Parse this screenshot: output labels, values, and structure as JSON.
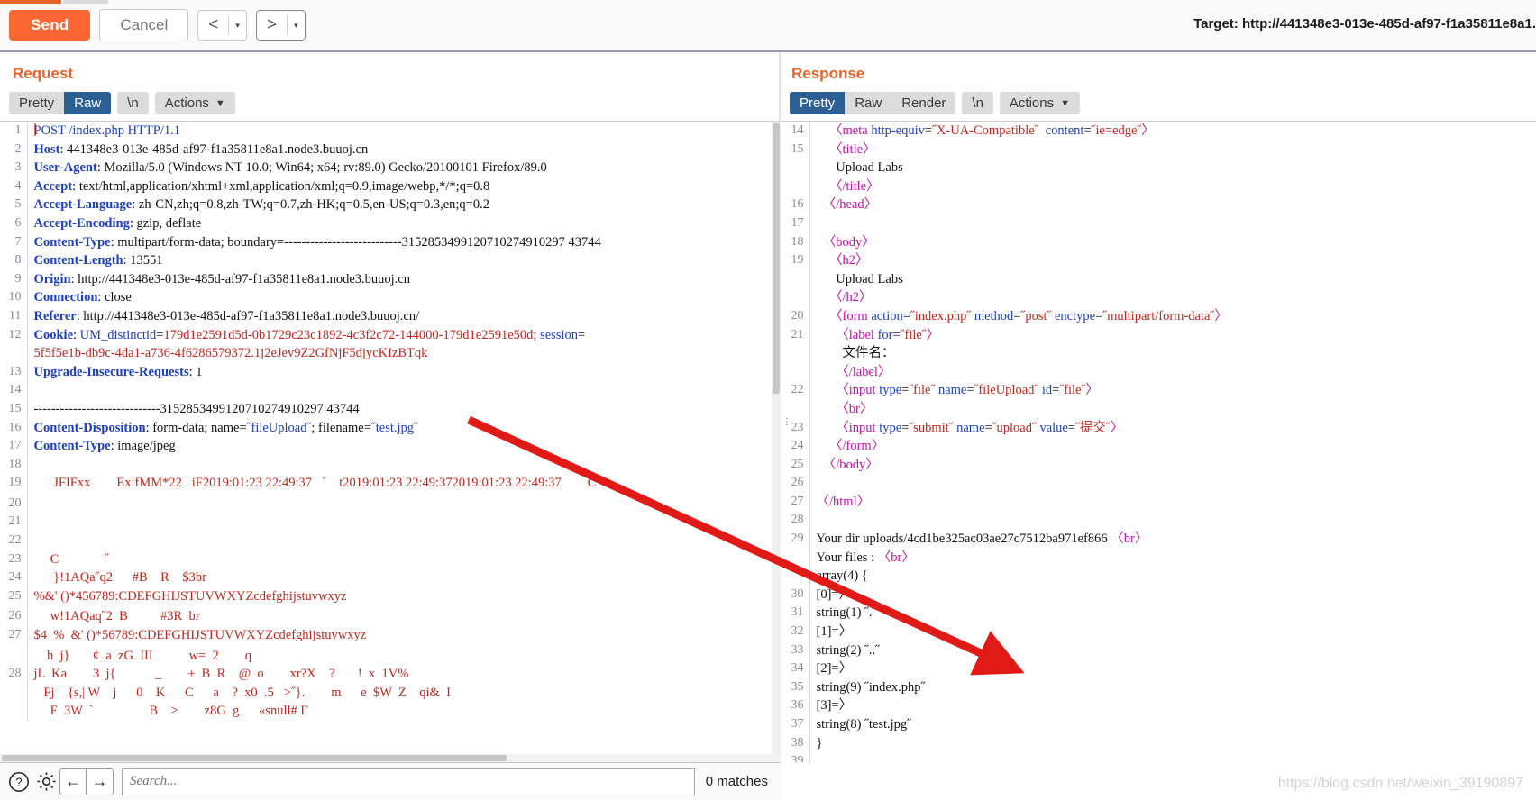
{
  "toolbar": {
    "send_label": "Send",
    "cancel_label": "Cancel",
    "prev_arrow": "<",
    "next_arrow": ">",
    "caret": "▾",
    "target_label": "Target: http://441348e3-013e-485d-af97-f1a35811e8a1."
  },
  "request": {
    "title": "Request",
    "tabs": {
      "pretty": "Pretty",
      "raw": "Raw",
      "newline": "\\n",
      "actions": "Actions"
    },
    "search_placeholder": "Search...",
    "matches": "0 matches",
    "lines": [
      {
        "n": "1",
        "segs": [
          {
            "t": "POST /index.php HTTP/1.1",
            "c": "blue"
          }
        ],
        "caret": true
      },
      {
        "n": "2",
        "segs": [
          {
            "t": "Host",
            "c": "hdrname"
          },
          {
            "t": ": ",
            "c": "blk"
          },
          {
            "t": "441348e3-013e-485d-af97-f1a35811e8a1.node3.buuoj.cn",
            "c": "blk"
          }
        ]
      },
      {
        "n": "3",
        "segs": [
          {
            "t": "User-Agent",
            "c": "hdrname"
          },
          {
            "t": ": Mozilla/5.0 (Windows NT 10.0; Win64; x64; rv:89.0) Gecko/20100101 Firefox/89.0",
            "c": "blk"
          }
        ]
      },
      {
        "n": "4",
        "segs": [
          {
            "t": "Accept",
            "c": "hdrname"
          },
          {
            "t": ": text/html,application/xhtml+xml,application/xml;q=0.9,image/webp,*/*;q=0.8",
            "c": "blk"
          }
        ]
      },
      {
        "n": "5",
        "segs": [
          {
            "t": "Accept-Language",
            "c": "hdrname"
          },
          {
            "t": ": zh-CN,zh;q=0.8,zh-TW;q=0.7,zh-HK;q=0.5,en-US;q=0.3,en;q=0.2",
            "c": "blk"
          }
        ]
      },
      {
        "n": "6",
        "segs": [
          {
            "t": "Accept-Encoding",
            "c": "hdrname"
          },
          {
            "t": ": gzip, deflate",
            "c": "blk"
          }
        ]
      },
      {
        "n": "7",
        "segs": [
          {
            "t": "Content-Type",
            "c": "hdrname"
          },
          {
            "t": ": multipart/form-data; boundary=---------------------------3152853499120710274910297 43744",
            "c": "blk"
          }
        ]
      },
      {
        "n": "8",
        "segs": [
          {
            "t": "Content-Length",
            "c": "hdrname"
          },
          {
            "t": ": 13551",
            "c": "blk"
          }
        ]
      },
      {
        "n": "9",
        "segs": [
          {
            "t": "Origin",
            "c": "hdrname"
          },
          {
            "t": ": http://441348e3-013e-485d-af97-f1a35811e8a1.node3.buuoj.cn",
            "c": "blk"
          }
        ]
      },
      {
        "n": "10",
        "segs": [
          {
            "t": "Connection",
            "c": "hdrname"
          },
          {
            "t": ": close",
            "c": "blk"
          }
        ]
      },
      {
        "n": "11",
        "segs": [
          {
            "t": "Referer",
            "c": "hdrname"
          },
          {
            "t": ": http://441348e3-013e-485d-af97-f1a35811e8a1.node3.buuoj.cn/",
            "c": "blk"
          }
        ]
      },
      {
        "n": "12",
        "segs": [
          {
            "t": "Cookie",
            "c": "hdrname"
          },
          {
            "t": ": ",
            "c": "blk"
          },
          {
            "t": "UM_distinctid",
            "c": "blue"
          },
          {
            "t": "=",
            "c": "blk"
          },
          {
            "t": "179d1e2591d5d-0b1729c23c1892-4c3f2c72-144000-179d1e2591e50d",
            "c": "red"
          },
          {
            "t": "; ",
            "c": "blk"
          },
          {
            "t": "session",
            "c": "blue"
          },
          {
            "t": "=",
            "c": "blk"
          }
        ]
      },
      {
        "n": "",
        "segs": [
          {
            "t": "5f5f5e1b-db9c-4da1-a736-4f6286579372.1j2eJev9Z2GfNjF5djycKIzBTqk",
            "c": "red"
          }
        ]
      },
      {
        "n": "13",
        "segs": [
          {
            "t": "Upgrade-Insecure-Requests",
            "c": "hdrname"
          },
          {
            "t": ": 1",
            "c": "blk"
          }
        ]
      },
      {
        "n": "14",
        "segs": [
          {
            "t": "",
            "c": "blk"
          }
        ]
      },
      {
        "n": "15",
        "segs": [
          {
            "t": "-----------------------------3152853499120710274910297 43744",
            "c": "blk"
          }
        ]
      },
      {
        "n": "16",
        "segs": [
          {
            "t": "Content-Disposition",
            "c": "hdrname"
          },
          {
            "t": ": form-data; name=",
            "c": "blk"
          },
          {
            "t": "˝",
            "c": "blue"
          },
          {
            "t": "fileUpload",
            "c": "blue"
          },
          {
            "t": "˝",
            "c": "blue"
          },
          {
            "t": "; filename=",
            "c": "blk"
          },
          {
            "t": "˝test.jpg˝",
            "c": "blue"
          }
        ]
      },
      {
        "n": "17",
        "segs": [
          {
            "t": "Content-Type",
            "c": "hdrname"
          },
          {
            "t": ": image/jpeg",
            "c": "blk"
          }
        ]
      },
      {
        "n": "18",
        "segs": [
          {
            "t": "",
            "c": "blk"
          }
        ]
      },
      {
        "n": "19",
        "segs": [
          {
            "t": "      JFIFxx        ExifMM*22   iF2019:01:23 22:49:37   `    t2019:01:23 22:49:372019:01:23 22:49:37        C",
            "c": "red"
          }
        ]
      },
      {
        "n": "",
        "segs": [
          {
            "t": "",
            "c": "blk"
          }
        ]
      },
      {
        "n": "20",
        "segs": [
          {
            "t": "",
            "c": "blk"
          }
        ]
      },
      {
        "n": "21",
        "segs": [
          {
            "t": "",
            "c": "blk"
          }
        ]
      },
      {
        "n": "22",
        "segs": [
          {
            "t": "",
            "c": "blk"
          }
        ]
      },
      {
        "n": "23",
        "segs": [
          {
            "t": "     C              ˝",
            "c": "red"
          }
        ]
      },
      {
        "n": "24",
        "segs": [
          {
            "t": "      }!1AQa˝q2      #B    R    $3br",
            "c": "red"
          }
        ]
      },
      {
        "n": "25",
        "segs": [
          {
            "t": "%&' ()*456789:CDEFGHIJSTUVWXYZcdefghijstuvwxyz",
            "c": "red"
          }
        ]
      },
      {
        "n": "",
        "segs": [
          {
            "t": "",
            "c": "blk"
          }
        ]
      },
      {
        "n": "26",
        "segs": [
          {
            "t": "     w!1AQaq˝2  B          #3R  br",
            "c": "red"
          }
        ]
      },
      {
        "n": "27",
        "segs": [
          {
            "t": "$4  %  &' ()*56789:CDEFGHIJSTUVWXYZcdefghijstuvwxyz",
            "c": "red"
          }
        ]
      },
      {
        "n": "",
        "segs": [
          {
            "t": "",
            "c": "blk"
          }
        ]
      },
      {
        "n": "",
        "segs": [
          {
            "t": "    h  j}       ¢  a  zG  III           w=  2        q",
            "c": "red"
          }
        ]
      },
      {
        "n": "28",
        "segs": [
          {
            "t": "jL  Ka        3  j{            _        +  B  R    @  o        xr?X    ?       !  x  1V%",
            "c": "red"
          }
        ]
      },
      {
        "n": "",
        "segs": [
          {
            "t": "   Fj    {s,| W    j      0    K      C      a    ?  x0  .5   >˝}.        m      e  $W  Z    qi&  I",
            "c": "red"
          }
        ]
      },
      {
        "n": "",
        "segs": [
          {
            "t": "     F  3W  `                 B    >        z8G  g      «snull# Г",
            "c": "red"
          }
        ]
      }
    ]
  },
  "response": {
    "title": "Response",
    "tabs": {
      "pretty": "Pretty",
      "raw": "Raw",
      "render": "Render",
      "newline": "\\n",
      "actions": "Actions"
    },
    "search_placeholder": "Search...",
    "lines": [
      {
        "n": "14",
        "segs": [
          {
            "t": "    ",
            "c": "blk"
          },
          {
            "t": "〈meta ",
            "c": "pink"
          },
          {
            "t": "http-equiv",
            "c": "blue"
          },
          {
            "t": "=",
            "c": "blk"
          },
          {
            "t": "˝X-UA-Compatible˝",
            "c": "red"
          },
          {
            "t": "  ",
            "c": "blk"
          },
          {
            "t": "content",
            "c": "blue"
          },
          {
            "t": "=",
            "c": "blk"
          },
          {
            "t": "˝ie=edge˝",
            "c": "red"
          },
          {
            "t": "〉",
            "c": "pink"
          }
        ],
        "gmark": true
      },
      {
        "n": "15",
        "segs": [
          {
            "t": "    ",
            "c": "blk"
          },
          {
            "t": "〈title〉",
            "c": "pink"
          }
        ]
      },
      {
        "n": "",
        "segs": [
          {
            "t": "      Upload Labs",
            "c": "blk"
          }
        ]
      },
      {
        "n": "",
        "segs": [
          {
            "t": "    ",
            "c": "blk"
          },
          {
            "t": "〈/title〉",
            "c": "pink"
          }
        ]
      },
      {
        "n": "16",
        "segs": [
          {
            "t": "  ",
            "c": "blk"
          },
          {
            "t": "〈/head〉",
            "c": "pink"
          }
        ]
      },
      {
        "n": "17",
        "segs": [
          {
            "t": "",
            "c": "blk"
          }
        ]
      },
      {
        "n": "18",
        "segs": [
          {
            "t": "  ",
            "c": "blk"
          },
          {
            "t": "〈body〉",
            "c": "pink"
          }
        ]
      },
      {
        "n": "19",
        "segs": [
          {
            "t": "    ",
            "c": "blk"
          },
          {
            "t": "〈h2〉",
            "c": "pink"
          }
        ]
      },
      {
        "n": "",
        "segs": [
          {
            "t": "      Upload Labs",
            "c": "blk"
          }
        ]
      },
      {
        "n": "",
        "segs": [
          {
            "t": "    ",
            "c": "blk"
          },
          {
            "t": "〈/h2〉",
            "c": "pink"
          }
        ]
      },
      {
        "n": "20",
        "segs": [
          {
            "t": "    ",
            "c": "blk"
          },
          {
            "t": "〈form ",
            "c": "pink"
          },
          {
            "t": "action",
            "c": "blue"
          },
          {
            "t": "=",
            "c": "blk"
          },
          {
            "t": "˝index.php˝",
            "c": "red"
          },
          {
            "t": " ",
            "c": "blk"
          },
          {
            "t": "method",
            "c": "blue"
          },
          {
            "t": "=",
            "c": "blk"
          },
          {
            "t": "˝post˝",
            "c": "red"
          },
          {
            "t": " ",
            "c": "blk"
          },
          {
            "t": "enctype",
            "c": "blue"
          },
          {
            "t": "=",
            "c": "blk"
          },
          {
            "t": "˝multipart/form-data˝",
            "c": "red"
          },
          {
            "t": "〉",
            "c": "pink"
          }
        ]
      },
      {
        "n": "21",
        "segs": [
          {
            "t": "      ",
            "c": "blk"
          },
          {
            "t": "〈label ",
            "c": "pink"
          },
          {
            "t": "for",
            "c": "blue"
          },
          {
            "t": "=",
            "c": "blk"
          },
          {
            "t": "˝file˝",
            "c": "red"
          },
          {
            "t": "〉",
            "c": "pink"
          }
        ]
      },
      {
        "n": "",
        "segs": [
          {
            "t": "        文件名：",
            "c": "blk"
          }
        ]
      },
      {
        "n": "",
        "segs": [
          {
            "t": "      ",
            "c": "blk"
          },
          {
            "t": "〈/label〉",
            "c": "pink"
          }
        ]
      },
      {
        "n": "22",
        "segs": [
          {
            "t": "      ",
            "c": "blk"
          },
          {
            "t": "〈input ",
            "c": "pink"
          },
          {
            "t": "type",
            "c": "blue"
          },
          {
            "t": "=",
            "c": "blk"
          },
          {
            "t": "˝file˝",
            "c": "red"
          },
          {
            "t": " ",
            "c": "blk"
          },
          {
            "t": "name",
            "c": "blue"
          },
          {
            "t": "=",
            "c": "blk"
          },
          {
            "t": "˝fileUpload˝",
            "c": "red"
          },
          {
            "t": " ",
            "c": "blk"
          },
          {
            "t": "id",
            "c": "blue"
          },
          {
            "t": "=",
            "c": "blk"
          },
          {
            "t": "˝file˝",
            "c": "red"
          },
          {
            "t": "〉",
            "c": "pink"
          }
        ]
      },
      {
        "n": "",
        "segs": [
          {
            "t": "      ",
            "c": "blk"
          },
          {
            "t": "〈br〉",
            "c": "pink"
          }
        ]
      },
      {
        "n": "23",
        "segs": [
          {
            "t": "      ",
            "c": "blk"
          },
          {
            "t": "〈input ",
            "c": "pink"
          },
          {
            "t": "type",
            "c": "blue"
          },
          {
            "t": "=",
            "c": "blk"
          },
          {
            "t": "˝submit˝",
            "c": "red"
          },
          {
            "t": " ",
            "c": "blk"
          },
          {
            "t": "name",
            "c": "blue"
          },
          {
            "t": "=",
            "c": "blk"
          },
          {
            "t": "˝upload˝",
            "c": "red"
          },
          {
            "t": " ",
            "c": "blk"
          },
          {
            "t": "value",
            "c": "blue"
          },
          {
            "t": "=",
            "c": "blk"
          },
          {
            "t": "˝提交˝",
            "c": "red"
          },
          {
            "t": "〉",
            "c": "pink"
          }
        ],
        "dots": true
      },
      {
        "n": "24",
        "segs": [
          {
            "t": "    ",
            "c": "blk"
          },
          {
            "t": "〈/form〉",
            "c": "pink"
          }
        ]
      },
      {
        "n": "25",
        "segs": [
          {
            "t": "  ",
            "c": "blk"
          },
          {
            "t": "〈/body〉",
            "c": "pink"
          }
        ]
      },
      {
        "n": "26",
        "segs": [
          {
            "t": "",
            "c": "blk"
          }
        ]
      },
      {
        "n": "27",
        "segs": [
          {
            "t": "〈/html〉",
            "c": "pink"
          }
        ]
      },
      {
        "n": "28",
        "segs": [
          {
            "t": "",
            "c": "blk"
          }
        ]
      },
      {
        "n": "29",
        "segs": [
          {
            "t": "Your dir uploads/4cd1be325ac03ae27c7512ba971ef866 ",
            "c": "blk"
          },
          {
            "t": "〈br〉",
            "c": "pink"
          }
        ]
      },
      {
        "n": "",
        "segs": [
          {
            "t": "Your files : ",
            "c": "blk"
          },
          {
            "t": "〈br〉",
            "c": "pink"
          }
        ]
      },
      {
        "n": "",
        "segs": [
          {
            "t": "array(4) {",
            "c": "blk"
          }
        ]
      },
      {
        "n": "30",
        "segs": [
          {
            "t": "[0]=〉",
            "c": "blk"
          }
        ]
      },
      {
        "n": "31",
        "segs": [
          {
            "t": "string(1) ˝.˝",
            "c": "blk"
          }
        ]
      },
      {
        "n": "32",
        "segs": [
          {
            "t": "[1]=〉",
            "c": "blk"
          }
        ]
      },
      {
        "n": "33",
        "segs": [
          {
            "t": "string(2) ˝..˝",
            "c": "blk"
          }
        ]
      },
      {
        "n": "34",
        "segs": [
          {
            "t": "[2]=〉",
            "c": "blk"
          }
        ]
      },
      {
        "n": "35",
        "segs": [
          {
            "t": "string(9) ˝index.php˝",
            "c": "blk"
          }
        ]
      },
      {
        "n": "36",
        "segs": [
          {
            "t": "[3]=〉",
            "c": "blk"
          }
        ]
      },
      {
        "n": "37",
        "segs": [
          {
            "t": "string(8) ˝test.jpg˝",
            "c": "blk"
          }
        ]
      },
      {
        "n": "38",
        "segs": [
          {
            "t": "}",
            "c": "blk"
          }
        ]
      },
      {
        "n": "39",
        "segs": [
          {
            "t": "",
            "c": "blk"
          }
        ]
      }
    ]
  },
  "icons": {
    "help": "help-icon",
    "settings": "gear-icon",
    "prev": "←",
    "next": "→"
  },
  "watermark": "https://blog.csdn.net/weixin_39190897",
  "colors": {
    "accent": "#fa6733",
    "heading": "#e8622a",
    "active_tab": "#2c5f94",
    "annotation": "#e01b17"
  }
}
